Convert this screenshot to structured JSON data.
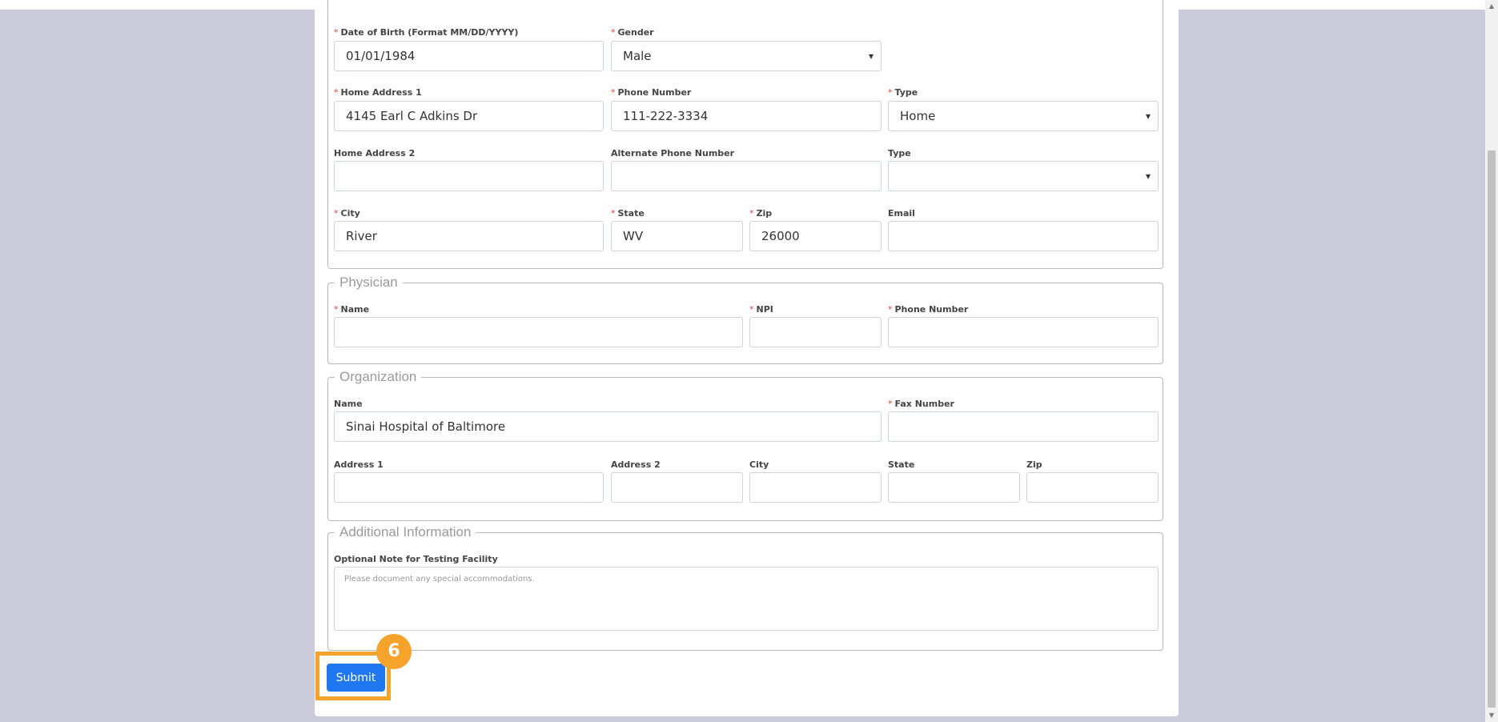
{
  "patient": {
    "dob": {
      "label": "Date of Birth (Format MM/DD/YYYY)",
      "value": "01/01/1984"
    },
    "gender": {
      "label": "Gender",
      "value": "Male"
    },
    "home_address1": {
      "label": "Home Address 1",
      "value": "4145 Earl C Adkins Dr"
    },
    "phone": {
      "label": "Phone Number",
      "value": "111-222-3334"
    },
    "phone_type": {
      "label": "Type",
      "value": "Home"
    },
    "home_address2": {
      "label": "Home Address 2",
      "value": ""
    },
    "alt_phone": {
      "label": "Alternate Phone Number",
      "value": ""
    },
    "alt_phone_type": {
      "label": "Type",
      "value": ""
    },
    "city": {
      "label": "City",
      "value": "River"
    },
    "state": {
      "label": "State",
      "value": "WV"
    },
    "zip": {
      "label": "Zip",
      "value": "26000"
    },
    "email": {
      "label": "Email",
      "value": ""
    }
  },
  "physician": {
    "legend": "Physician",
    "name": {
      "label": "Name",
      "value": ""
    },
    "npi": {
      "label": "NPI",
      "value": ""
    },
    "phone": {
      "label": "Phone Number",
      "value": ""
    }
  },
  "organization": {
    "legend": "Organization",
    "name": {
      "label": "Name",
      "value": "Sinai Hospital of Baltimore"
    },
    "fax": {
      "label": "Fax Number",
      "value": ""
    },
    "address1": {
      "label": "Address 1",
      "value": ""
    },
    "address2": {
      "label": "Address 2",
      "value": ""
    },
    "city": {
      "label": "City",
      "value": ""
    },
    "state": {
      "label": "State",
      "value": ""
    },
    "zip": {
      "label": "Zip",
      "value": ""
    }
  },
  "additional": {
    "legend": "Additional Information",
    "note": {
      "label": "Optional Note for Testing Facility",
      "placeholder": "Please document any special accommodations."
    }
  },
  "required_marker": "*",
  "submit_label": "Submit",
  "step_badge": "6",
  "colors": {
    "accent": "#f5a32a",
    "button": "#1f78f0",
    "required": "#e24545"
  }
}
